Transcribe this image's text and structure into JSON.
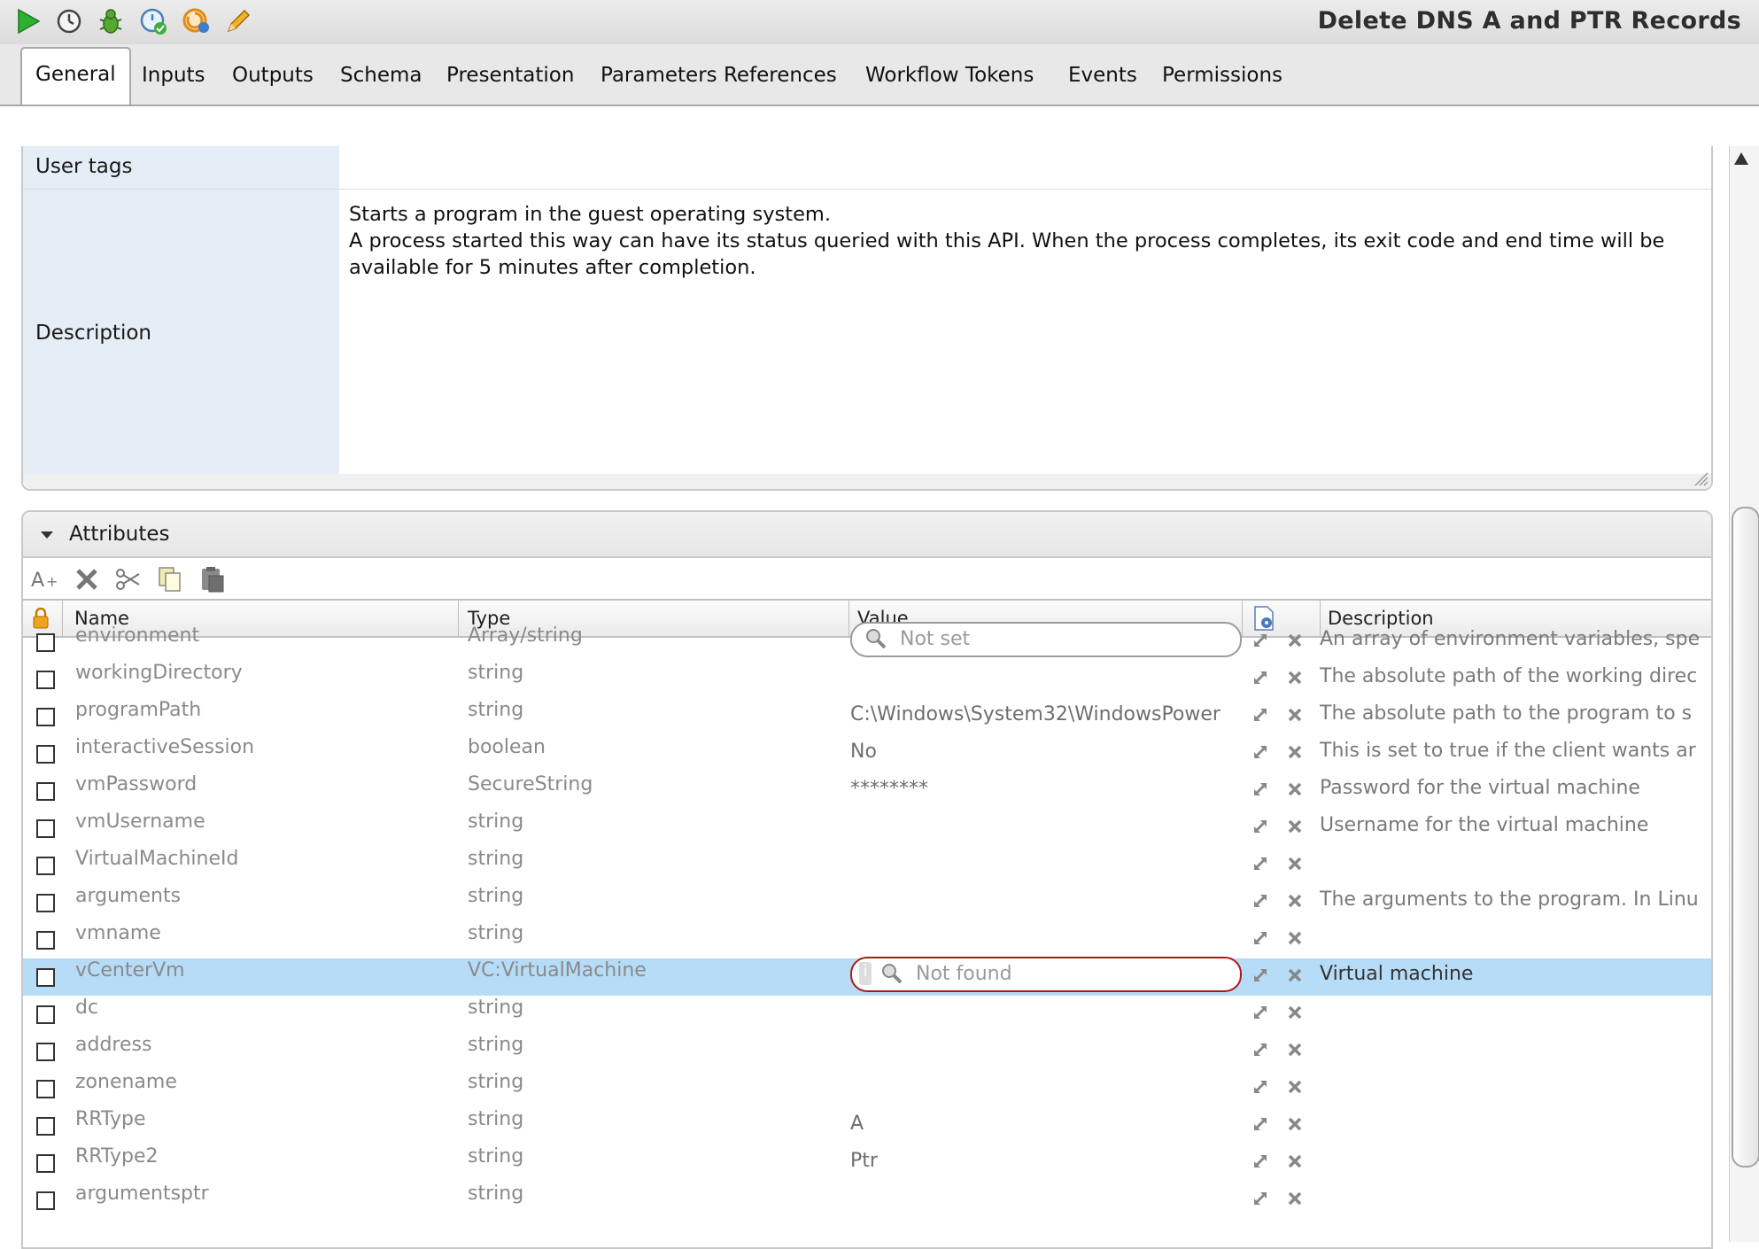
{
  "window": {
    "title": "Delete DNS A and PTR Records"
  },
  "toolbar": {
    "icons": [
      "run-icon",
      "schedule-icon",
      "debug-icon",
      "validate-icon",
      "refresh-icon",
      "edit-icon"
    ]
  },
  "tabs": [
    {
      "label": "General",
      "active": true
    },
    {
      "label": "Inputs"
    },
    {
      "label": "Outputs"
    },
    {
      "label": "Schema"
    },
    {
      "label": "Presentation"
    },
    {
      "label": "Parameters References"
    },
    {
      "label": "Workflow Tokens"
    },
    {
      "label": "Events"
    },
    {
      "label": "Permissions"
    }
  ],
  "general": {
    "user_tags_label": "User tags",
    "description_label": "Description",
    "description_line1": "Starts a program in the guest operating system.",
    "description_line2": "A process started this way can have its status queried with this API. When the process completes, its exit code and end time will be available for 5 minutes after completion."
  },
  "attributes": {
    "title": "Attributes",
    "columns": {
      "name": "Name",
      "type": "Type",
      "value": "Value",
      "description": "Description"
    },
    "rows": [
      {
        "name": "environment",
        "type": "Array/string",
        "value": "Not set",
        "value_kind": "search",
        "description": "An array of environment variables, spe"
      },
      {
        "name": "workingDirectory",
        "type": "string",
        "value": "",
        "description": "The absolute path of the working direc"
      },
      {
        "name": "programPath",
        "type": "string",
        "value": "C:\\Windows\\System32\\WindowsPower",
        "description": "The absolute path to the program to s"
      },
      {
        "name": "interactiveSession",
        "type": "boolean",
        "value": "No",
        "description": "This is set to true if the client wants ar"
      },
      {
        "name": "vmPassword",
        "type": "SecureString",
        "value": "********",
        "description": "Password for the virtual machine"
      },
      {
        "name": "vmUsername",
        "type": "string",
        "value": "",
        "description": "Username for the virtual machine"
      },
      {
        "name": "VirtualMachineId",
        "type": "string",
        "value": "",
        "description": ""
      },
      {
        "name": "arguments",
        "type": "string",
        "value": "",
        "description": "The arguments to the program. In Linu"
      },
      {
        "name": "vmname",
        "type": "string",
        "value": "",
        "description": ""
      },
      {
        "name": "vCenterVm",
        "type": "VC:VirtualMachine",
        "value": "Not found",
        "value_kind": "error",
        "description": "Virtual machine",
        "selected": true
      },
      {
        "name": "dc",
        "type": "string",
        "value": "",
        "description": ""
      },
      {
        "name": "address",
        "type": "string",
        "value": "",
        "description": ""
      },
      {
        "name": "zonename",
        "type": "string",
        "value": "",
        "description": ""
      },
      {
        "name": "RRType",
        "type": "string",
        "value": "A",
        "description": ""
      },
      {
        "name": "RRType2",
        "type": "string",
        "value": "Ptr",
        "description": ""
      },
      {
        "name": "argumentsptr",
        "type": "string",
        "value": "",
        "description": ""
      }
    ]
  },
  "colors": {
    "selection": "#b7dcf7",
    "label_bg": "#e5eef6",
    "error_border": "#b01818"
  }
}
